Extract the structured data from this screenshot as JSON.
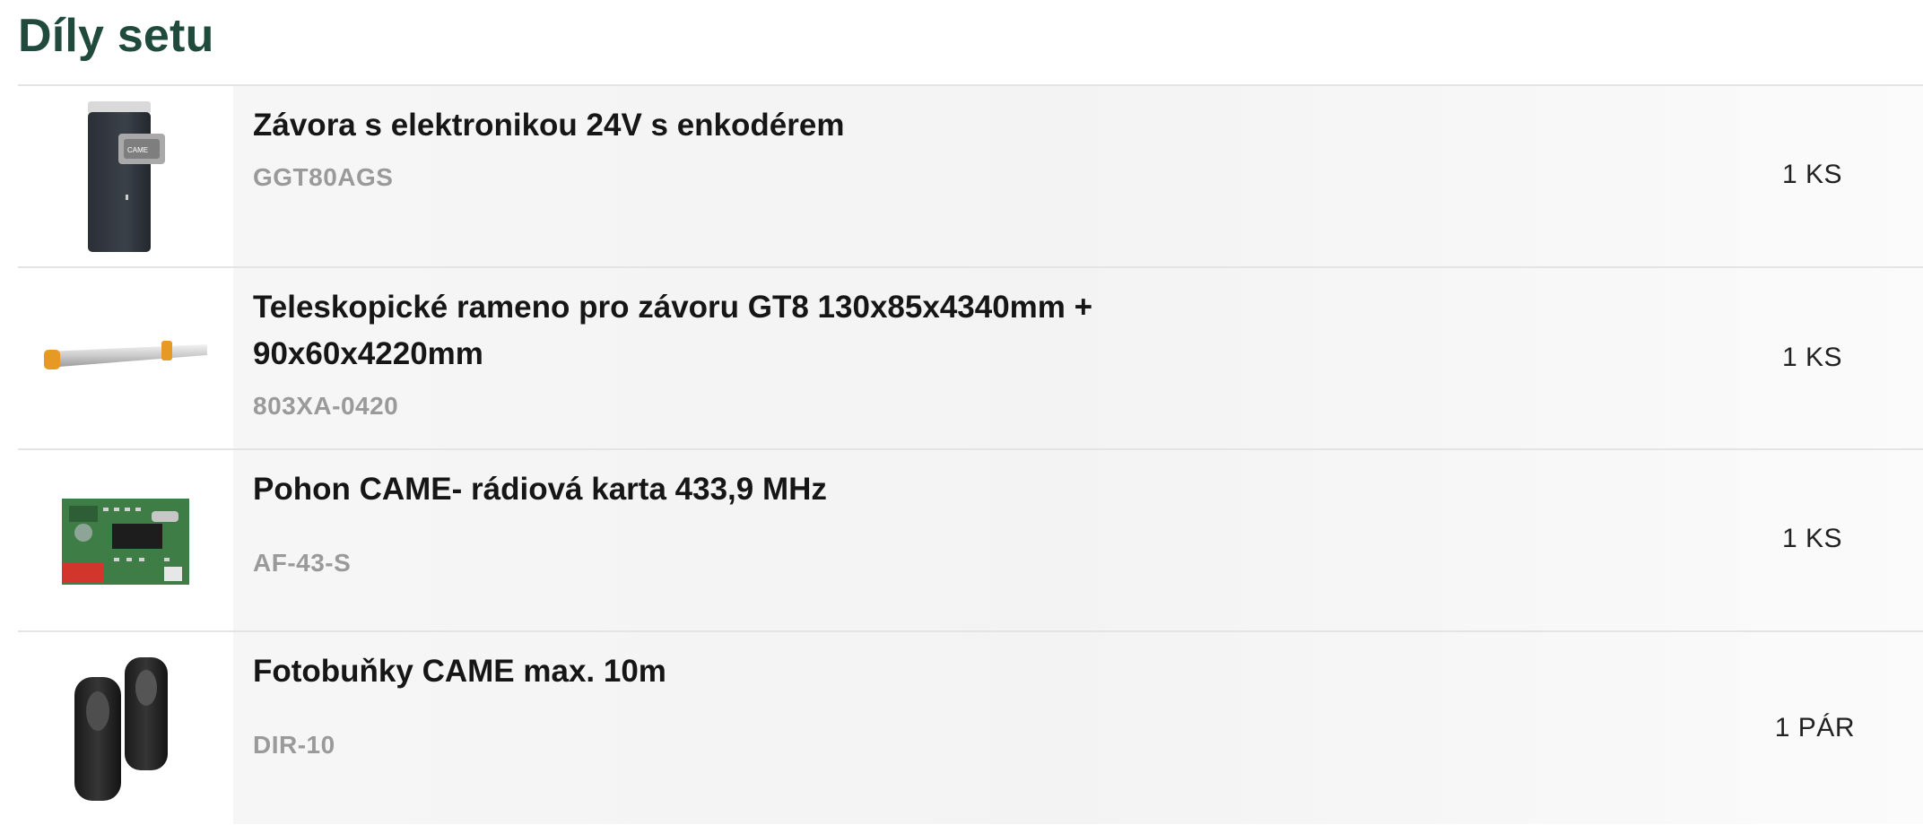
{
  "section": {
    "title": "Díly setu"
  },
  "items": [
    {
      "name": "Závora s elektronikou 24V s enkodérem",
      "code": "GGT80AGS",
      "quantity": "1 KS",
      "icon": "barrier-cabinet-image"
    },
    {
      "name": "Teleskopické rameno pro závoru GT8 130x85x4340mm + 90x60x4220mm",
      "code": "803XA-0420",
      "quantity": "1 KS",
      "icon": "barrier-arm-image"
    },
    {
      "name": "Pohon CAME- rádiová karta 433,9 MHz",
      "code": "AF-43-S",
      "quantity": "1 KS",
      "icon": "radio-card-image"
    },
    {
      "name": "Fotobuňky CAME max. 10m",
      "code": "DIR-10",
      "quantity": "1 PÁR",
      "icon": "photocell-pair-image"
    }
  ],
  "colors": {
    "title": "#1f4a3c",
    "code": "#9a9a9a",
    "divider": "#e4e4e4"
  }
}
